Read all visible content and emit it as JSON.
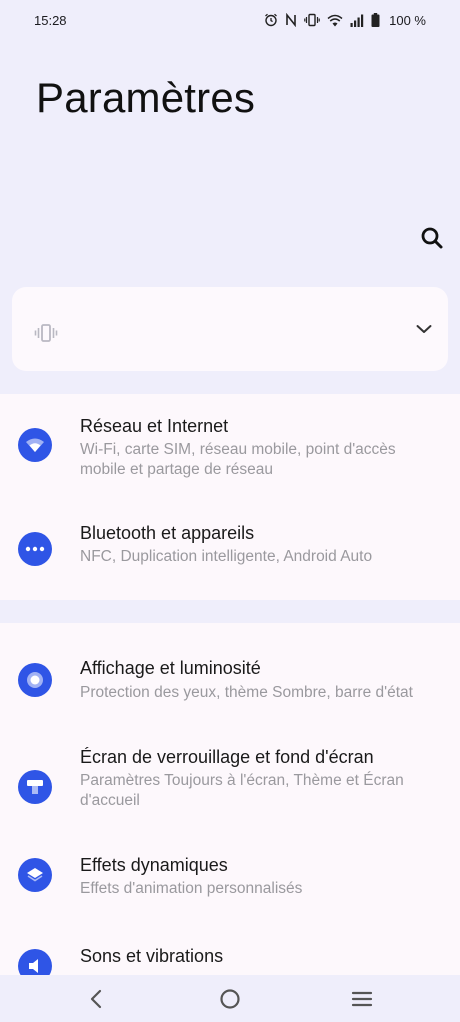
{
  "status": {
    "time": "15:28",
    "battery": "100 %",
    "icons": [
      "alarm-icon",
      "nfc-icon",
      "vibrate-icon",
      "wifi-icon",
      "signal-icon",
      "battery-icon"
    ]
  },
  "header": {
    "title": "Paramètres"
  },
  "quick_card": {
    "icon": "vibrate-icon",
    "expand_icon": "chevron-down-icon"
  },
  "settings": [
    {
      "title": "Réseau et Internet",
      "subtitle": "Wi-Fi, carte SIM, réseau mobile, point d'accès mobile et partage de réseau",
      "icon": "wifi-icon"
    },
    {
      "title": "Bluetooth et appareils",
      "subtitle": "NFC, Duplication intelligente, Android Auto",
      "icon": "more-dots-icon"
    },
    {
      "title": "Affichage et luminosité",
      "subtitle": "Protection des yeux, thème Sombre, barre d'état",
      "icon": "brightness-icon"
    },
    {
      "title": "Écran de verrouillage et fond d'écran",
      "subtitle": "Paramètres Toujours à l'écran, Thème et Écran d'accueil",
      "icon": "wallpaper-icon"
    },
    {
      "title": "Effets dynamiques",
      "subtitle": "Effets d'animation personnalisés",
      "icon": "layers-icon"
    },
    {
      "title": "Sons et vibrations",
      "subtitle": "",
      "icon": "sound-icon"
    }
  ],
  "nav": {
    "back": "back-icon",
    "home": "home-icon",
    "menu": "menu-icon"
  },
  "colors": {
    "accent": "#2f55e6",
    "background": "#efeefb",
    "card": "#fdf8fc"
  }
}
